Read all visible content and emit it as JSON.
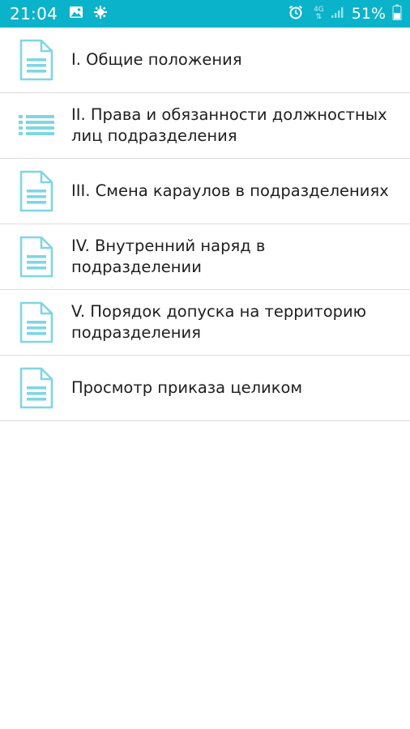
{
  "status_bar": {
    "time": "21:04",
    "network_label": "4G",
    "battery_percent": "51%",
    "color": "#0ab3c9",
    "icons": [
      "image-icon",
      "notification-icon",
      "alarm-icon",
      "signal-icon",
      "battery-icon"
    ]
  },
  "items": [
    {
      "label": "I. Общие положения",
      "icon": "document-icon"
    },
    {
      "label": "II. Права и обязанности должностных лиц подразделения",
      "icon": "list-icon"
    },
    {
      "label": "III. Смена караулов в подразделениях",
      "icon": "document-icon"
    },
    {
      "label": "IV. Внутренний наряд в подразделении",
      "icon": "document-icon"
    },
    {
      "label": "V. Порядок допуска на территорию подразделения",
      "icon": "document-icon"
    },
    {
      "label": "Просмотр приказа целиком",
      "icon": "document-icon"
    }
  ],
  "icon_color": "#7fd6e3"
}
